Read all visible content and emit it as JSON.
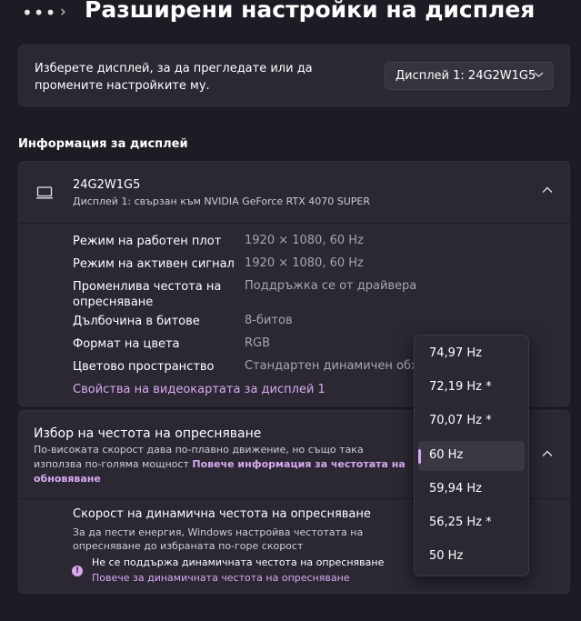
{
  "header": {
    "dots": "•••",
    "chevron": "›",
    "title": "Разширени настройки на дисплея"
  },
  "selector": {
    "text": "Изберете дисплей, за да прегледате или да промените настройките му.",
    "value": "Дисплей 1: 24G2W1G5"
  },
  "section_title": "Информация за дисплей",
  "display": {
    "name": "24G2W1G5",
    "subtitle": "Дисплей 1: свързан към NVIDIA GeForce RTX 4070 SUPER",
    "rows": [
      {
        "label": "Режим на работен плот",
        "value": "1920 × 1080, 60 Hz"
      },
      {
        "label": "Режим на активен сигнал",
        "value": "1920 × 1080, 60 Hz"
      },
      {
        "label": "Променлива честота на опресняване",
        "value": "Поддръжка се от драйвера"
      },
      {
        "label": "Дълбочина в битове",
        "value": "8-битов"
      },
      {
        "label": "Формат на цвета",
        "value": "RGB"
      },
      {
        "label": "Цветово пространство",
        "value": "Стандартен динамичен обхват"
      }
    ],
    "adapter_link": "Свойства на видеокартата за дисплей 1"
  },
  "refresh": {
    "title": "Избор на честота на опресняване",
    "desc": "По-високата скорост дава по-плавно движение, но също така използва по-голяма мощност",
    "link": "Повече информация за честотата на обновяване",
    "options": [
      "74,97 Hz",
      "72,19 Hz *",
      "70,07 Hz *",
      "60 Hz",
      "59,94 Hz",
      "56,25 Hz *",
      "50 Hz"
    ],
    "selected": "60 Hz"
  },
  "dynamic": {
    "title": "Скорост на динамична честота на опресняване",
    "desc": "За да пести енергия, Windows настройва честотата на опресняване до избраната по-горе скорост",
    "warning": "Не се поддържа динамичната честота на опресняване",
    "link": "Повече за динамичната честота на опресняване",
    "warn_glyph": "!"
  },
  "colors": {
    "accent": "#d8a9f0",
    "background": "#1f1b25",
    "card": "#2b2733"
  },
  "icons": {
    "monitor": "monitor-icon",
    "chevron_up": "chevron-up-icon",
    "chevron_down": "chevron-down-icon",
    "info": "info-icon"
  }
}
